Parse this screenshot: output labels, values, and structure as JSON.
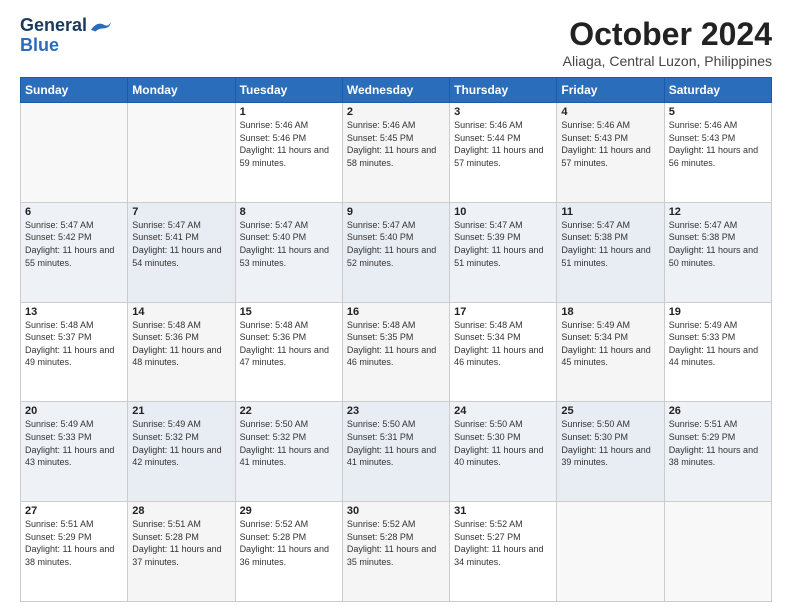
{
  "header": {
    "logo_general": "General",
    "logo_blue": "Blue",
    "month_title": "October 2024",
    "location": "Aliaga, Central Luzon, Philippines"
  },
  "weekdays": [
    "Sunday",
    "Monday",
    "Tuesday",
    "Wednesday",
    "Thursday",
    "Friday",
    "Saturday"
  ],
  "weeks": [
    [
      {
        "day": "",
        "sunrise": "",
        "sunset": "",
        "daylight": ""
      },
      {
        "day": "",
        "sunrise": "",
        "sunset": "",
        "daylight": ""
      },
      {
        "day": "1",
        "sunrise": "Sunrise: 5:46 AM",
        "sunset": "Sunset: 5:46 PM",
        "daylight": "Daylight: 11 hours and 59 minutes."
      },
      {
        "day": "2",
        "sunrise": "Sunrise: 5:46 AM",
        "sunset": "Sunset: 5:45 PM",
        "daylight": "Daylight: 11 hours and 58 minutes."
      },
      {
        "day": "3",
        "sunrise": "Sunrise: 5:46 AM",
        "sunset": "Sunset: 5:44 PM",
        "daylight": "Daylight: 11 hours and 57 minutes."
      },
      {
        "day": "4",
        "sunrise": "Sunrise: 5:46 AM",
        "sunset": "Sunset: 5:43 PM",
        "daylight": "Daylight: 11 hours and 57 minutes."
      },
      {
        "day": "5",
        "sunrise": "Sunrise: 5:46 AM",
        "sunset": "Sunset: 5:43 PM",
        "daylight": "Daylight: 11 hours and 56 minutes."
      }
    ],
    [
      {
        "day": "6",
        "sunrise": "Sunrise: 5:47 AM",
        "sunset": "Sunset: 5:42 PM",
        "daylight": "Daylight: 11 hours and 55 minutes."
      },
      {
        "day": "7",
        "sunrise": "Sunrise: 5:47 AM",
        "sunset": "Sunset: 5:41 PM",
        "daylight": "Daylight: 11 hours and 54 minutes."
      },
      {
        "day": "8",
        "sunrise": "Sunrise: 5:47 AM",
        "sunset": "Sunset: 5:40 PM",
        "daylight": "Daylight: 11 hours and 53 minutes."
      },
      {
        "day": "9",
        "sunrise": "Sunrise: 5:47 AM",
        "sunset": "Sunset: 5:40 PM",
        "daylight": "Daylight: 11 hours and 52 minutes."
      },
      {
        "day": "10",
        "sunrise": "Sunrise: 5:47 AM",
        "sunset": "Sunset: 5:39 PM",
        "daylight": "Daylight: 11 hours and 51 minutes."
      },
      {
        "day": "11",
        "sunrise": "Sunrise: 5:47 AM",
        "sunset": "Sunset: 5:38 PM",
        "daylight": "Daylight: 11 hours and 51 minutes."
      },
      {
        "day": "12",
        "sunrise": "Sunrise: 5:47 AM",
        "sunset": "Sunset: 5:38 PM",
        "daylight": "Daylight: 11 hours and 50 minutes."
      }
    ],
    [
      {
        "day": "13",
        "sunrise": "Sunrise: 5:48 AM",
        "sunset": "Sunset: 5:37 PM",
        "daylight": "Daylight: 11 hours and 49 minutes."
      },
      {
        "day": "14",
        "sunrise": "Sunrise: 5:48 AM",
        "sunset": "Sunset: 5:36 PM",
        "daylight": "Daylight: 11 hours and 48 minutes."
      },
      {
        "day": "15",
        "sunrise": "Sunrise: 5:48 AM",
        "sunset": "Sunset: 5:36 PM",
        "daylight": "Daylight: 11 hours and 47 minutes."
      },
      {
        "day": "16",
        "sunrise": "Sunrise: 5:48 AM",
        "sunset": "Sunset: 5:35 PM",
        "daylight": "Daylight: 11 hours and 46 minutes."
      },
      {
        "day": "17",
        "sunrise": "Sunrise: 5:48 AM",
        "sunset": "Sunset: 5:34 PM",
        "daylight": "Daylight: 11 hours and 46 minutes."
      },
      {
        "day": "18",
        "sunrise": "Sunrise: 5:49 AM",
        "sunset": "Sunset: 5:34 PM",
        "daylight": "Daylight: 11 hours and 45 minutes."
      },
      {
        "day": "19",
        "sunrise": "Sunrise: 5:49 AM",
        "sunset": "Sunset: 5:33 PM",
        "daylight": "Daylight: 11 hours and 44 minutes."
      }
    ],
    [
      {
        "day": "20",
        "sunrise": "Sunrise: 5:49 AM",
        "sunset": "Sunset: 5:33 PM",
        "daylight": "Daylight: 11 hours and 43 minutes."
      },
      {
        "day": "21",
        "sunrise": "Sunrise: 5:49 AM",
        "sunset": "Sunset: 5:32 PM",
        "daylight": "Daylight: 11 hours and 42 minutes."
      },
      {
        "day": "22",
        "sunrise": "Sunrise: 5:50 AM",
        "sunset": "Sunset: 5:32 PM",
        "daylight": "Daylight: 11 hours and 41 minutes."
      },
      {
        "day": "23",
        "sunrise": "Sunrise: 5:50 AM",
        "sunset": "Sunset: 5:31 PM",
        "daylight": "Daylight: 11 hours and 41 minutes."
      },
      {
        "day": "24",
        "sunrise": "Sunrise: 5:50 AM",
        "sunset": "Sunset: 5:30 PM",
        "daylight": "Daylight: 11 hours and 40 minutes."
      },
      {
        "day": "25",
        "sunrise": "Sunrise: 5:50 AM",
        "sunset": "Sunset: 5:30 PM",
        "daylight": "Daylight: 11 hours and 39 minutes."
      },
      {
        "day": "26",
        "sunrise": "Sunrise: 5:51 AM",
        "sunset": "Sunset: 5:29 PM",
        "daylight": "Daylight: 11 hours and 38 minutes."
      }
    ],
    [
      {
        "day": "27",
        "sunrise": "Sunrise: 5:51 AM",
        "sunset": "Sunset: 5:29 PM",
        "daylight": "Daylight: 11 hours and 38 minutes."
      },
      {
        "day": "28",
        "sunrise": "Sunrise: 5:51 AM",
        "sunset": "Sunset: 5:28 PM",
        "daylight": "Daylight: 11 hours and 37 minutes."
      },
      {
        "day": "29",
        "sunrise": "Sunrise: 5:52 AM",
        "sunset": "Sunset: 5:28 PM",
        "daylight": "Daylight: 11 hours and 36 minutes."
      },
      {
        "day": "30",
        "sunrise": "Sunrise: 5:52 AM",
        "sunset": "Sunset: 5:28 PM",
        "daylight": "Daylight: 11 hours and 35 minutes."
      },
      {
        "day": "31",
        "sunrise": "Sunrise: 5:52 AM",
        "sunset": "Sunset: 5:27 PM",
        "daylight": "Daylight: 11 hours and 34 minutes."
      },
      {
        "day": "",
        "sunrise": "",
        "sunset": "",
        "daylight": ""
      },
      {
        "day": "",
        "sunrise": "",
        "sunset": "",
        "daylight": ""
      }
    ]
  ]
}
